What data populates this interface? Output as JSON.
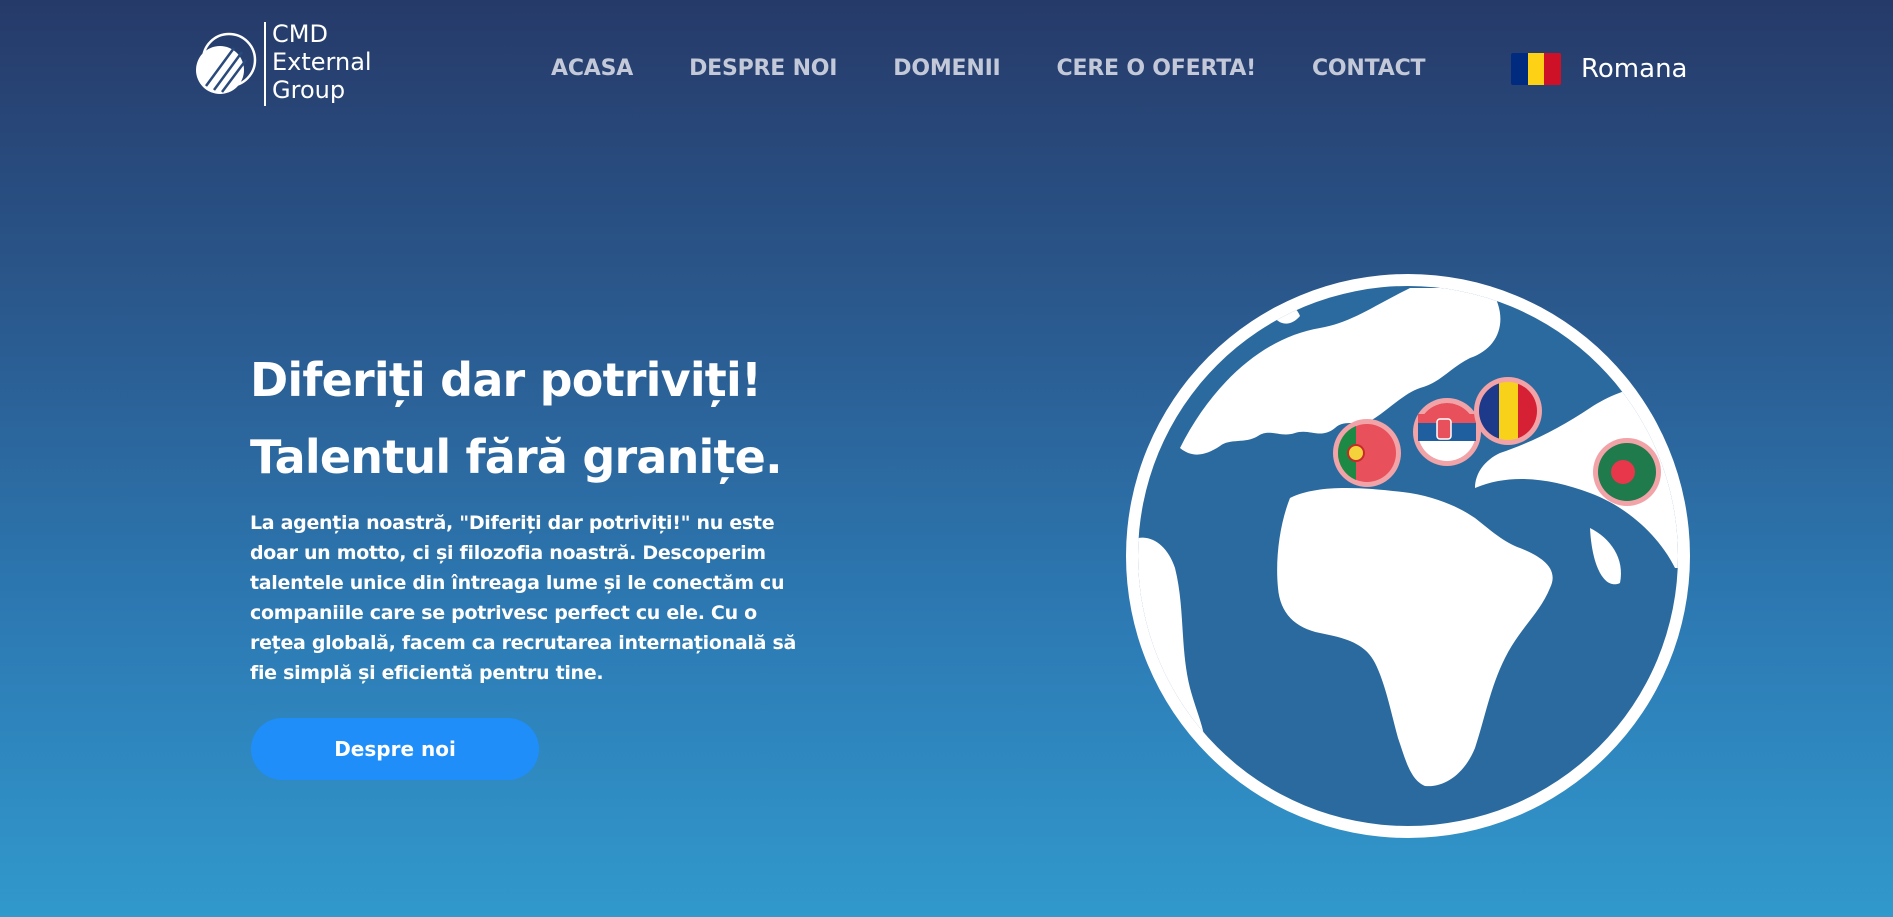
{
  "brand": {
    "line1": "CMD",
    "line2": "External",
    "line3": "Group"
  },
  "nav": {
    "items": [
      "ACASA",
      "DESPRE NOI",
      "DOMENII",
      "CERE O OFERTA!",
      "CONTACT"
    ]
  },
  "language": {
    "label": "Romana",
    "flag_colors": [
      "#002b7f",
      "#fcd116",
      "#ce1126"
    ]
  },
  "hero": {
    "title_line1": "Diferiți dar potriviți!",
    "title_line2": "Talentul fără granițe.",
    "body": "La agenția noastră, \"Diferiți dar potriviți!\" nu este doar un motto, ci și filozofia noastră. Descoperim talentele unice din întreaga lume și le conectăm cu companiile care se potrivesc perfect cu ele. Cu o rețea globală, facem ca recrutarea internațională să fie simplă și eficientă pentru tine.",
    "cta_label": "Despre noi"
  },
  "globe": {
    "flags": [
      "Portugal",
      "Serbia",
      "Romania",
      "Bangladesh"
    ]
  },
  "colors": {
    "accent": "#1f8ef9",
    "nav_text": "#c3c9d8"
  }
}
